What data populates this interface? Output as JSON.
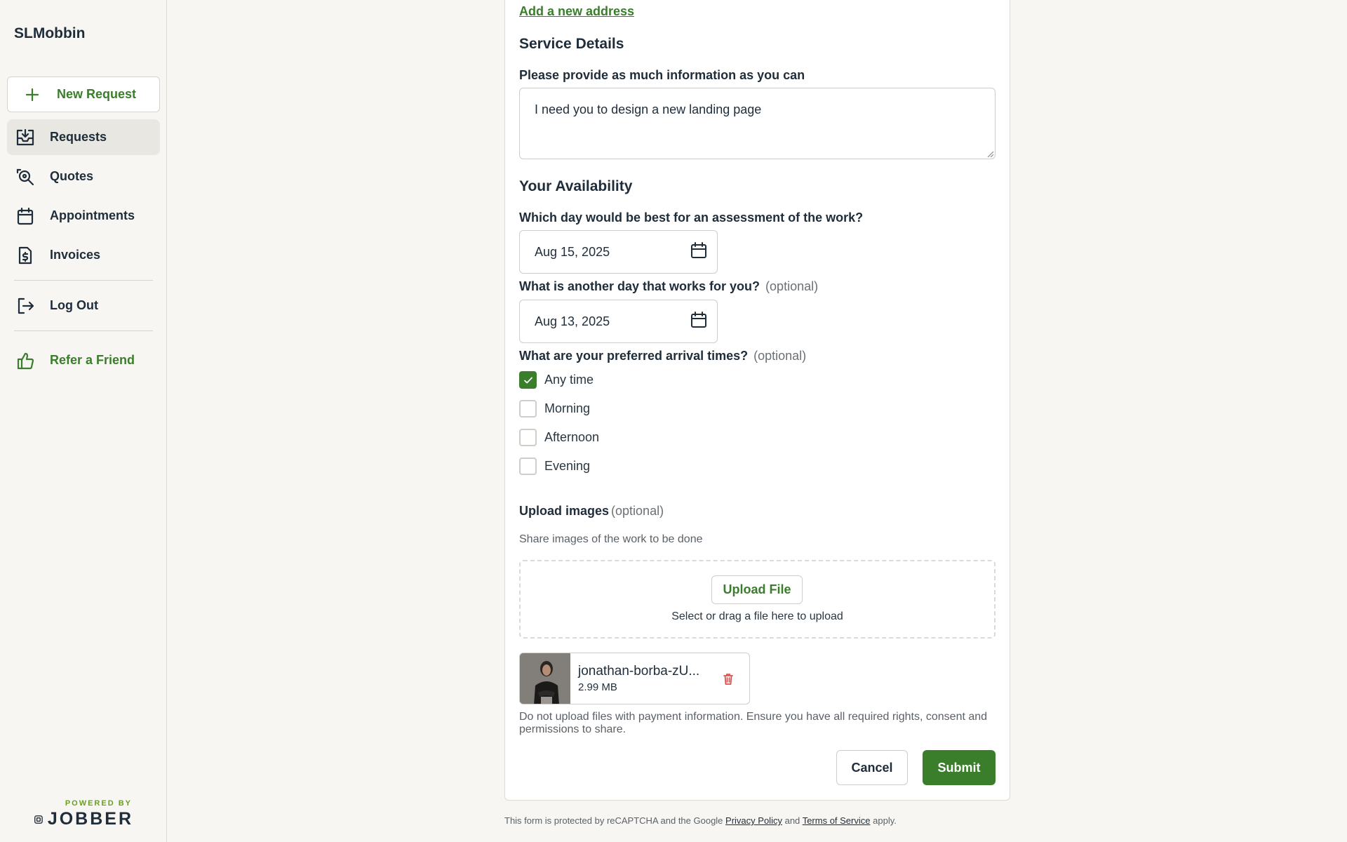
{
  "sidebar": {
    "brand": "SLMobbin",
    "new_request_label": "New Request",
    "items": [
      {
        "label": "Requests",
        "icon": "inbox-icon",
        "active": true
      },
      {
        "label": "Quotes",
        "icon": "quote-search-icon",
        "active": false
      },
      {
        "label": "Appointments",
        "icon": "calendar-icon",
        "active": false
      },
      {
        "label": "Invoices",
        "icon": "invoice-dollar-icon",
        "active": false
      }
    ],
    "logout_label": "Log Out",
    "refer_label": "Refer a Friend",
    "powered_by": "POWERED BY",
    "powered_brand": "JOBBER"
  },
  "form": {
    "add_address_link": "Add a new address",
    "service_details_heading": "Service Details",
    "info_label": "Please provide as much information as you can",
    "info_value": "I need you to design a new landing page",
    "availability_heading": "Your Availability",
    "first_day_label": "Which day would be best for an assessment of the work?",
    "first_day_value": "Aug 15, 2025",
    "second_day_label": "What is another day that works for you?",
    "second_day_value": "Aug 13, 2025",
    "optional_text": "(optional)",
    "arrival_label": "What are your preferred arrival times?",
    "arrival_options": [
      {
        "label": "Any time",
        "checked": true
      },
      {
        "label": "Morning",
        "checked": false
      },
      {
        "label": "Afternoon",
        "checked": false
      },
      {
        "label": "Evening",
        "checked": false
      }
    ],
    "upload_label": "Upload images",
    "upload_sub": "Share images of the work to be done",
    "upload_button": "Upload File",
    "upload_hint": "Select or drag a file here to upload",
    "file": {
      "name": "jonathan-borba-zU...",
      "size": "2.99 MB"
    },
    "disclaimer": "Do not upload files with payment information. Ensure you have all required rights, consent and permissions to share.",
    "cancel_label": "Cancel",
    "submit_label": "Submit"
  },
  "footer": {
    "prefix": "This form is protected by reCAPTCHA and the Google",
    "privacy_link": "Privacy Policy",
    "and_text": "and",
    "terms_link": "Terms of Service",
    "suffix": "apply."
  },
  "colors": {
    "accent": "#3a7d2a",
    "text": "#1f2d3a",
    "background": "#f7f6f3",
    "danger": "#d9534f"
  }
}
